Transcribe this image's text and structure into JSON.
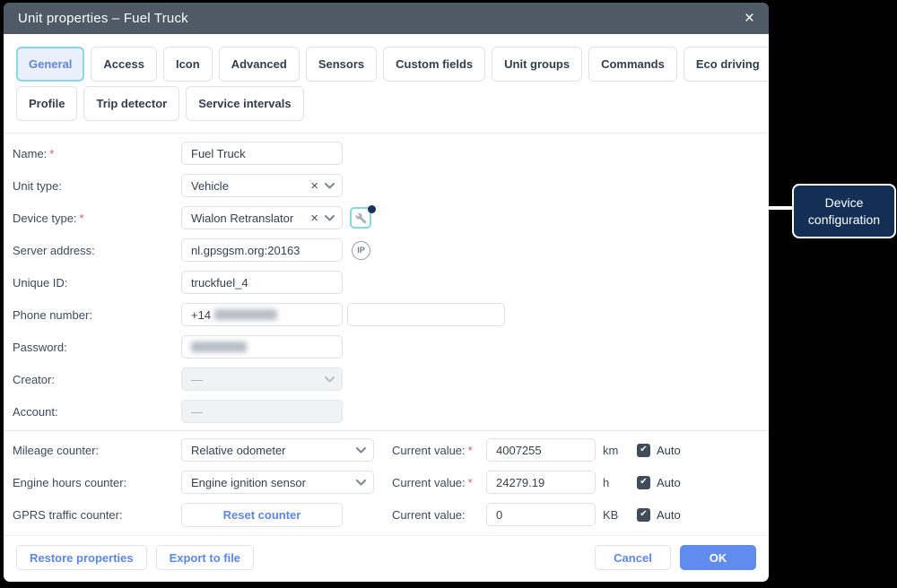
{
  "window": {
    "title": "Unit properties – Fuel Truck",
    "close_glyph": "×"
  },
  "tabs": {
    "active": "General",
    "row1": [
      "General",
      "Access",
      "Icon",
      "Advanced",
      "Sensors",
      "Custom fields",
      "Unit groups",
      "Commands",
      "Eco driving"
    ],
    "row2": [
      "Profile",
      "Trip detector",
      "Service intervals"
    ]
  },
  "fields": {
    "name": {
      "label": "Name:",
      "required": "*",
      "value": "Fuel Truck"
    },
    "unit_type": {
      "label": "Unit type:",
      "value": "Vehicle"
    },
    "device_type": {
      "label": "Device type:",
      "required": "*",
      "value": "Wialon Retranslator"
    },
    "server_address": {
      "label": "Server address:",
      "value": "nl.gpsgsm.org:20163"
    },
    "unique_id": {
      "label": "Unique ID:",
      "value": "truckfuel_4"
    },
    "phone_number": {
      "label": "Phone number:",
      "visible_value": "+14",
      "masked": true
    },
    "password": {
      "label": "Password:",
      "masked": true
    },
    "creator": {
      "label": "Creator:",
      "value": "—",
      "disabled": true
    },
    "account": {
      "label": "Account:",
      "value": "—",
      "disabled": true
    }
  },
  "counters": {
    "mileage": {
      "label": "Mileage counter:",
      "selected": "Relative odometer",
      "current_label": "Current value:",
      "required": "*",
      "value": "4007255",
      "unit": "km",
      "auto_label": "Auto",
      "auto_checked": true
    },
    "engine_hours": {
      "label": "Engine hours counter:",
      "selected": "Engine ignition sensor",
      "current_label": "Current value:",
      "required": "*",
      "value": "24279.19",
      "unit": "h",
      "auto_label": "Auto",
      "auto_checked": true
    },
    "gprs_traffic": {
      "label": "GPRS traffic counter:",
      "button_label": "Reset counter",
      "current_label": "Current value:",
      "value": "0",
      "unit": "KB",
      "auto_label": "Auto",
      "auto_checked": true
    }
  },
  "footer": {
    "restore": "Restore properties",
    "export": "Export to file",
    "cancel": "Cancel",
    "ok": "OK"
  },
  "callout": {
    "text": "Device configuration"
  },
  "icons": {
    "close": "×",
    "clear": "×",
    "check": "✔",
    "ip": "IP",
    "wrench": "wrench-icon",
    "chevron": "chevron-down-icon"
  },
  "colors": {
    "title_bar": "#4e5a66",
    "active_tab_border": "#87d7e9",
    "active_tab_bg": "#e9effb",
    "accent_blue": "#5f8cee",
    "required_red": "#e25757",
    "callout_bg": "#142f55",
    "checkbox_bg": "#3f4c59",
    "background": "#000000"
  }
}
